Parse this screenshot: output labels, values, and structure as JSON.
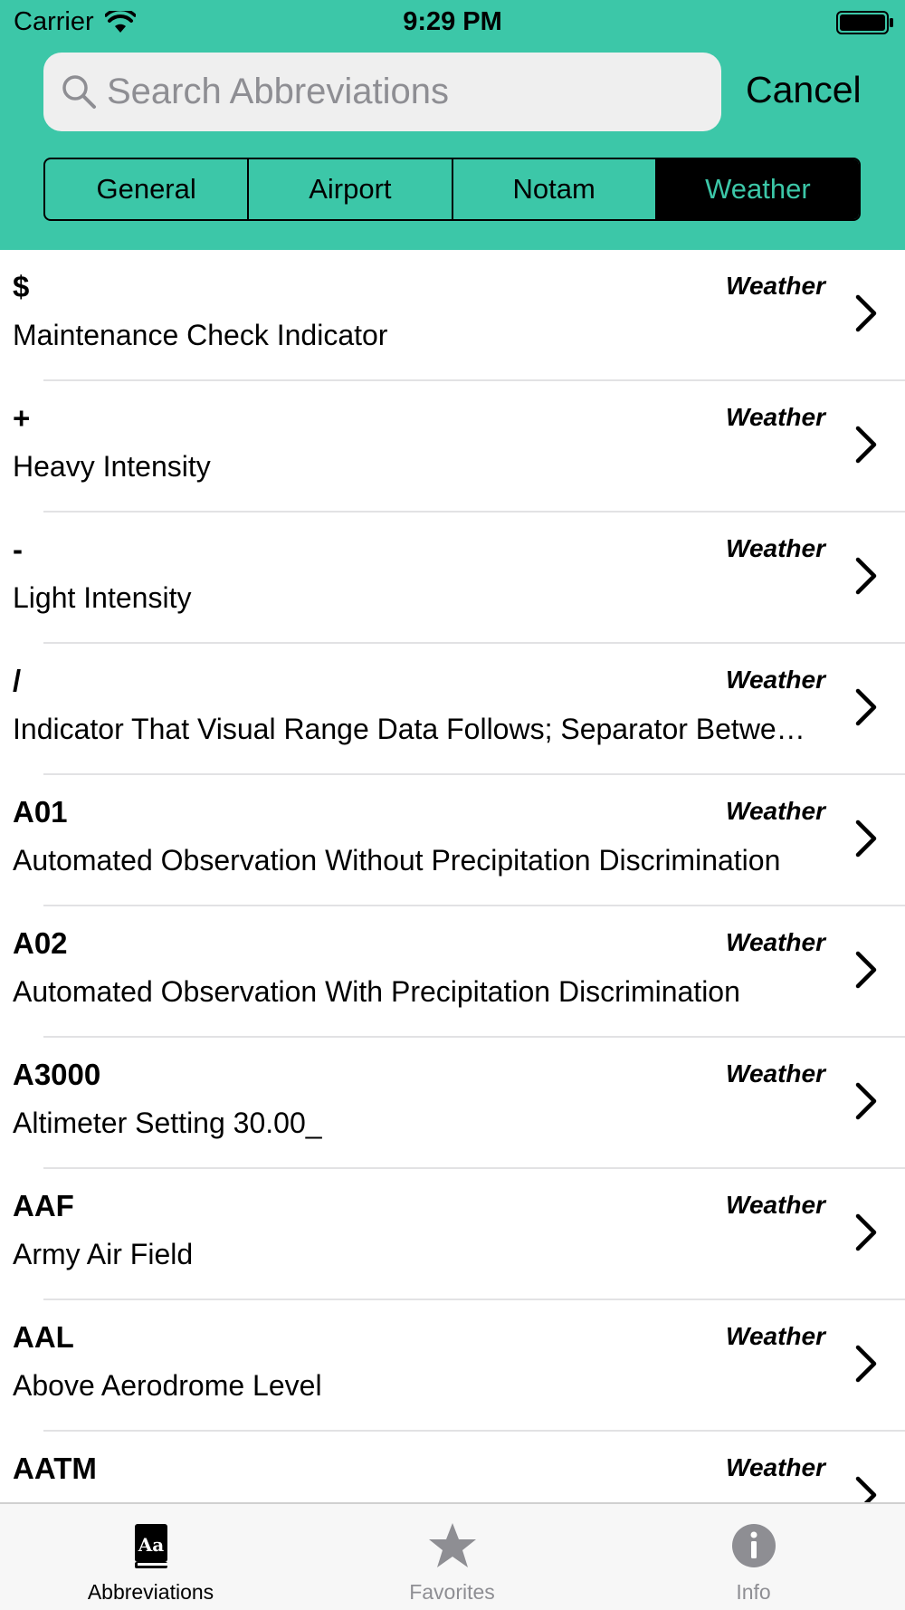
{
  "status_bar": {
    "carrier": "Carrier",
    "time": "9:29 PM"
  },
  "search": {
    "placeholder": "Search Abbreviations",
    "value": "",
    "cancel_label": "Cancel"
  },
  "segments": [
    {
      "label": "General",
      "selected": false
    },
    {
      "label": "Airport",
      "selected": false
    },
    {
      "label": "Notam",
      "selected": false
    },
    {
      "label": "Weather",
      "selected": true
    }
  ],
  "rows": [
    {
      "abbr": "$",
      "meaning": "Maintenance Check Indicator",
      "category": "Weather"
    },
    {
      "abbr": "+",
      "meaning": "Heavy Intensity",
      "category": "Weather"
    },
    {
      "abbr": "-",
      "meaning": "Light Intensity",
      "category": "Weather"
    },
    {
      "abbr": "/",
      "meaning": "Indicator That Visual Range Data Follows; Separator Between Temperature and Dew Point Data",
      "category": "Weather"
    },
    {
      "abbr": "A01",
      "meaning": "Automated Observation Without Precipitation Discrimination",
      "category": "Weather"
    },
    {
      "abbr": "A02",
      "meaning": "Automated Observation With Precipitation Discrimination",
      "category": "Weather"
    },
    {
      "abbr": "A3000",
      "meaning": "Altimeter Setting 30.00_",
      "category": "Weather"
    },
    {
      "abbr": "AAF",
      "meaning": "Army Air Field",
      "category": "Weather"
    },
    {
      "abbr": "AAL",
      "meaning": "Above Aerodrome Level",
      "category": "Weather"
    },
    {
      "abbr": "AATM",
      "meaning": "",
      "category": "Weather"
    }
  ],
  "tabs": [
    {
      "label": "Abbreviations",
      "icon": "book-icon",
      "active": true
    },
    {
      "label": "Favorites",
      "icon": "star-icon",
      "active": false
    },
    {
      "label": "Info",
      "icon": "info-icon",
      "active": false
    }
  ],
  "colors": {
    "accent": "#3cc7a8",
    "selected_segment_bg": "#000000",
    "inactive_tab": "#8e8e93"
  }
}
